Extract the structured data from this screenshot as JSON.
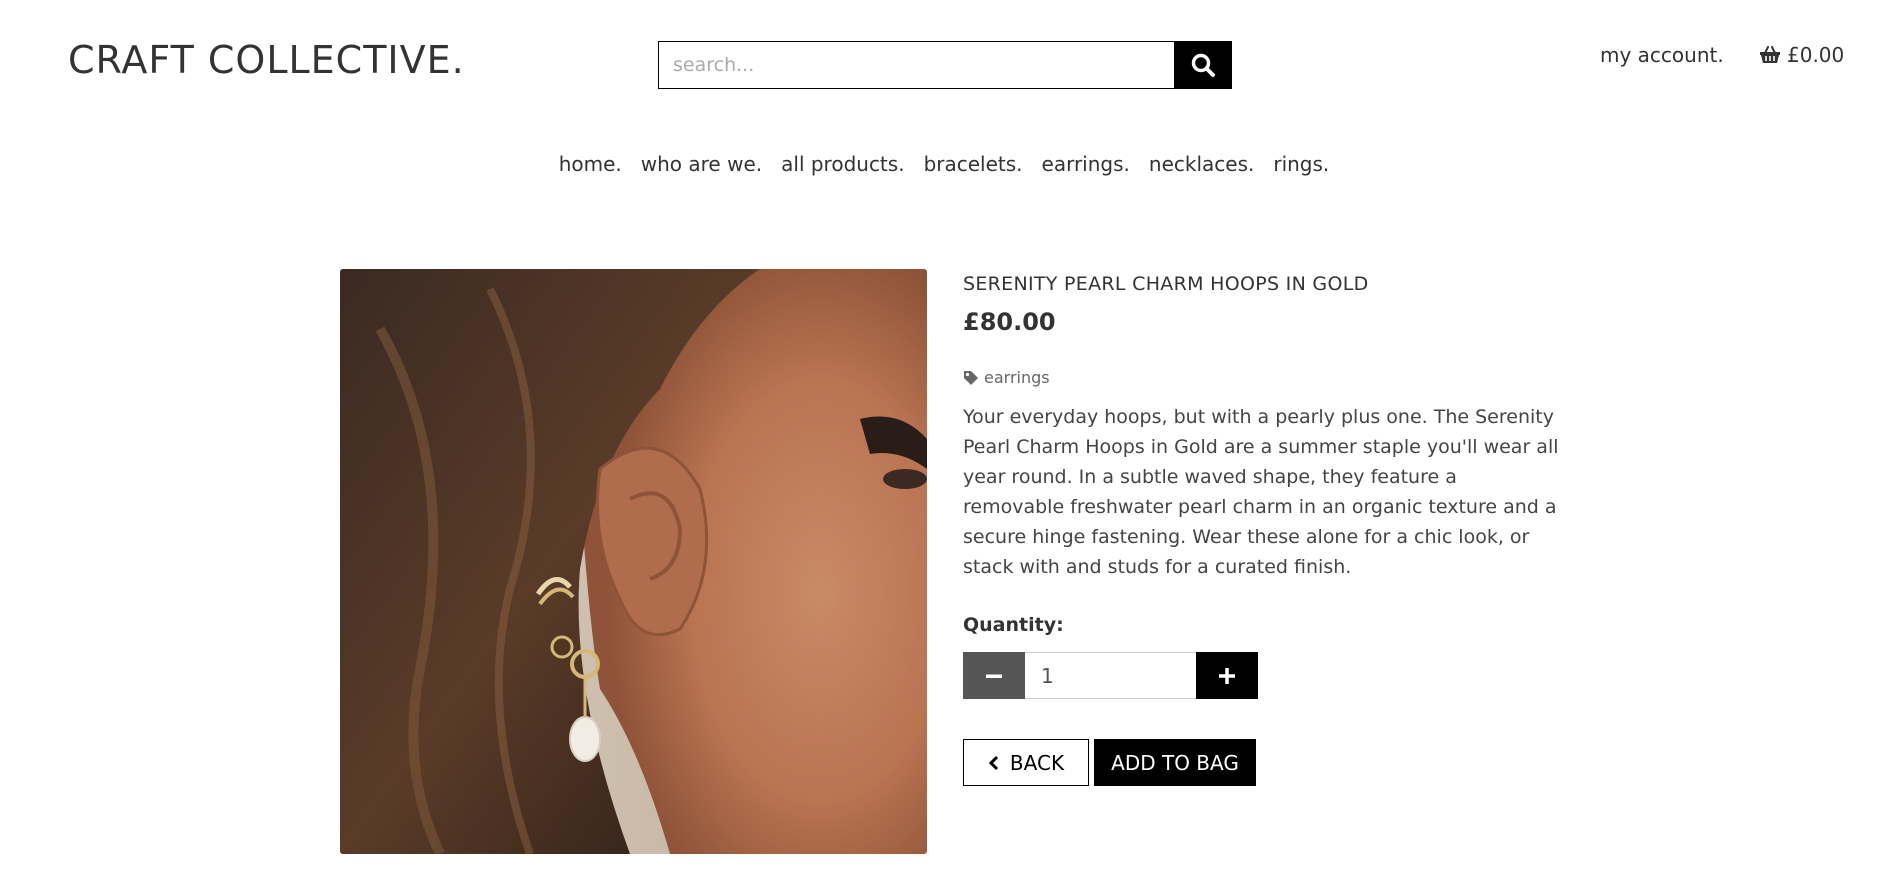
{
  "header": {
    "logo": "CRAFT COLLECTIVE.",
    "search_placeholder": "search...",
    "search_icon": "search-icon",
    "account_label": "my account.",
    "basket_icon": "basket-icon",
    "basket_total": "£0.00"
  },
  "nav": {
    "items": [
      {
        "label": "home."
      },
      {
        "label": "who are we."
      },
      {
        "label": "all products."
      },
      {
        "label": "bracelets."
      },
      {
        "label": "earrings."
      },
      {
        "label": "necklaces."
      },
      {
        "label": "rings."
      }
    ]
  },
  "product": {
    "title": "SERENITY PEARL CHARM HOOPS IN GOLD",
    "price": "£80.00",
    "category": "earrings",
    "tag_icon": "tag-icon",
    "description": "Your everyday hoops, but with a pearly plus one. The Serenity Pearl Charm Hoops in Gold are a summer staple you'll wear all year round. In a subtle waved shape, they feature a removable freshwater pearl charm in an organic texture and a secure hinge fastening. Wear these alone for a chic look, or stack with and studs for a curated finish.",
    "quantity_label": "Quantity:",
    "quantity_value": "1",
    "back_label": "BACK",
    "add_label": "ADD TO BAG"
  },
  "colors": {
    "primary": "#000000",
    "text": "#333333",
    "muted_button": "#555555"
  }
}
